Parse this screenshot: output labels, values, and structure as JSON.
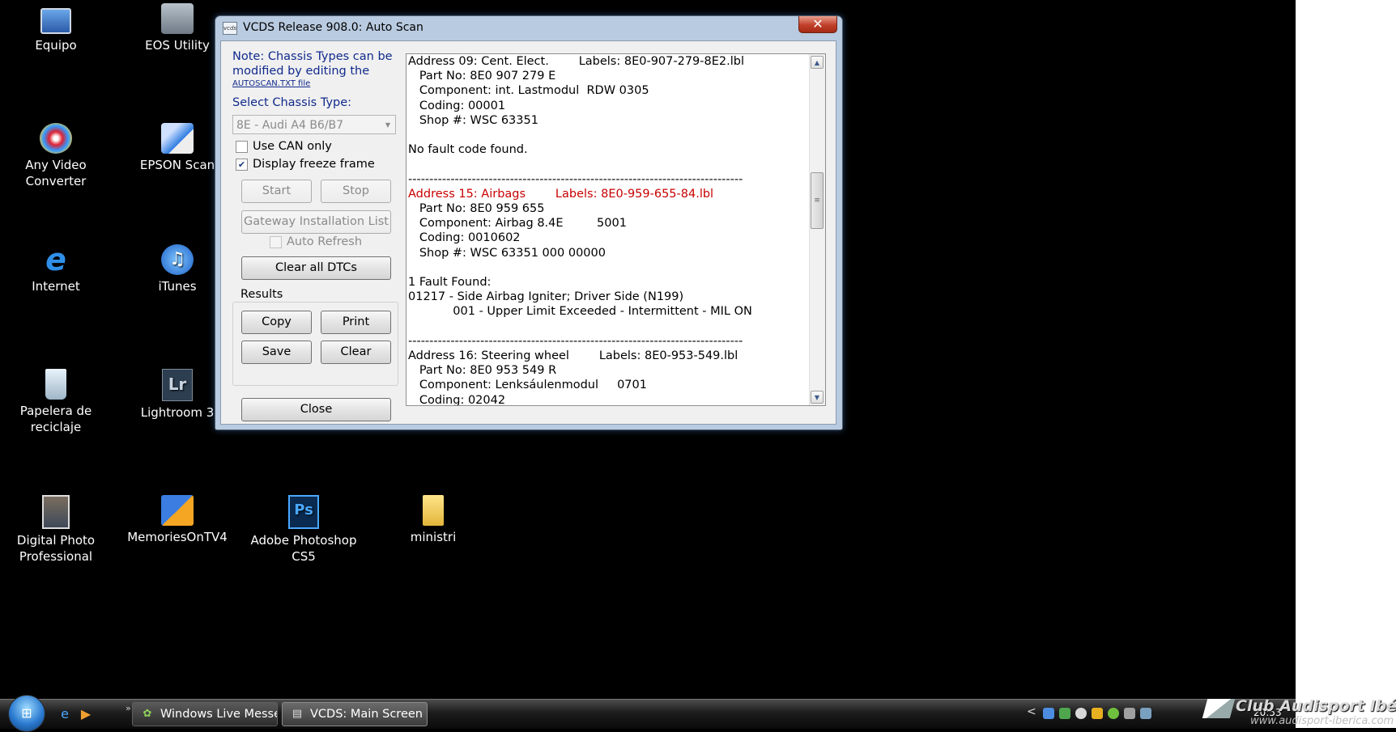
{
  "desktop": {
    "icons": [
      {
        "label": "Equipo",
        "icon": "computer-icon"
      },
      {
        "label": "EOS Utility",
        "icon": "printer-icon"
      },
      {
        "label": "Any Video Converter",
        "icon": "video-converter-icon"
      },
      {
        "label": "EPSON Scan",
        "icon": "scanner-icon"
      },
      {
        "label": "Internet",
        "icon": "internet-explorer-icon"
      },
      {
        "label": "iTunes",
        "icon": "itunes-icon"
      },
      {
        "label": "Papelera de reciclaje",
        "icon": "recycle-bin-icon"
      },
      {
        "label": "Lightroom 3",
        "icon": "lightroom-icon",
        "glyph": "Lr"
      },
      {
        "label": "Digital Photo Professional",
        "icon": "photo-app-icon"
      },
      {
        "label": "MemoriesOnTV4",
        "icon": "memories-tv-icon"
      },
      {
        "label": "Adobe Photoshop CS5",
        "icon": "photoshop-icon",
        "glyph": "Ps"
      },
      {
        "label": "ministri",
        "icon": "folder-icon"
      }
    ]
  },
  "window": {
    "title": "VCDS Release 908.0:  Auto Scan",
    "app_icon_text": "vcds",
    "close_glyph": "✕",
    "left_panel": {
      "note": "Note:  Chassis Types can be modified by editing the",
      "note_link": "AUTOSCAN.TXT file",
      "select_chassis_label": "Select Chassis Type:",
      "chassis_value": "8E - Audi A4 B6/B7",
      "use_can_only": {
        "label": "Use CAN only",
        "checked": false
      },
      "display_freeze_frame": {
        "label": "Display freeze frame",
        "checked": true
      },
      "start_label": "Start",
      "stop_label": "Stop",
      "gateway_label": "Gateway Installation List",
      "auto_refresh": {
        "label": "Auto Refresh",
        "checked": false
      },
      "clear_dtcs_label": "Clear all DTCs",
      "results_label": "Results",
      "copy_label": "Copy",
      "print_label": "Print",
      "save_label": "Save",
      "clear_label": "Clear",
      "close_label": "Close"
    },
    "log": {
      "lines": [
        {
          "text": "Address 09: Cent. Elect.        Labels: 8E0-907-279-8E2.lbl",
          "color": "#000000"
        },
        {
          "text": "   Part No: 8E0 907 279 E",
          "color": "#000000"
        },
        {
          "text": "   Component: int. Lastmodul  RDW 0305",
          "color": "#000000"
        },
        {
          "text": "   Coding: 00001",
          "color": "#000000"
        },
        {
          "text": "   Shop #: WSC 63351",
          "color": "#000000"
        },
        {
          "text": "",
          "color": "#000000"
        },
        {
          "text": "No fault code found.",
          "color": "#000000"
        },
        {
          "text": "",
          "color": "#000000"
        },
        {
          "text": "-------------------------------------------------------------------------------",
          "color": "#000000"
        },
        {
          "text": "Address 15: Airbags        Labels: 8E0-959-655-84.lbl",
          "color": "#c80000"
        },
        {
          "text": "   Part No: 8E0 959 655",
          "color": "#000000"
        },
        {
          "text": "   Component: Airbag 8.4E         5001",
          "color": "#000000"
        },
        {
          "text": "   Coding: 0010602",
          "color": "#000000"
        },
        {
          "text": "   Shop #: WSC 63351 000 00000",
          "color": "#000000"
        },
        {
          "text": "",
          "color": "#000000"
        },
        {
          "text": "1 Fault Found:",
          "color": "#000000"
        },
        {
          "text": "01217 - Side Airbag Igniter; Driver Side (N199)",
          "color": "#000000"
        },
        {
          "text": "            001 - Upper Limit Exceeded - Intermittent - MIL ON",
          "color": "#000000"
        },
        {
          "text": "",
          "color": "#000000"
        },
        {
          "text": "-------------------------------------------------------------------------------",
          "color": "#000000"
        },
        {
          "text": "Address 16: Steering wheel        Labels: 8E0-953-549.lbl",
          "color": "#000000"
        },
        {
          "text": "   Part No: 8E0 953 549 R",
          "color": "#000000"
        },
        {
          "text": "   Component: Lenksáulenmodul     0701",
          "color": "#000000"
        },
        {
          "text": "   Coding: 02042",
          "color": "#000000"
        }
      ]
    }
  },
  "taskbar": {
    "start_icon": "windows-start-icon",
    "more_glyph": "»",
    "tasks": [
      {
        "label": "Windows Live Messe...",
        "icon": "messenger-icon",
        "active": false
      },
      {
        "label": "VCDS:  Main Screen",
        "icon": "vcds-icon",
        "active": true
      }
    ],
    "tray_arrow": "<",
    "clock": "20:53"
  },
  "watermark": {
    "title": "Club Audisport Ibérica",
    "url": "www.audisport-iberica.com"
  },
  "colors": {
    "note_text": "#102a8c",
    "airbag_fault": "#c80000",
    "window_frame": "#b9cbe0"
  }
}
